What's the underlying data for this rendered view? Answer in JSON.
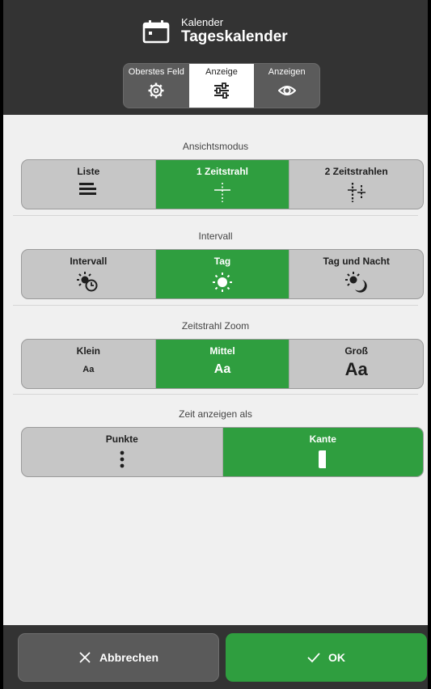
{
  "header": {
    "subtitle": "Kalender",
    "title": "Tageskalender",
    "icon": "calendar-icon",
    "tabs": [
      {
        "label": "Oberstes Feld",
        "icon": "gear-icon",
        "active": false
      },
      {
        "label": "Anzeige",
        "icon": "sliders-icon",
        "active": true
      },
      {
        "label": "Anzeigen",
        "icon": "eye-icon",
        "active": false
      }
    ]
  },
  "sections": {
    "view_mode": {
      "label": "Ansichtsmodus",
      "options": [
        {
          "label": "Liste",
          "icon": "list-icon"
        },
        {
          "label": "1 Zeitstrahl",
          "icon": "one-timeline-icon"
        },
        {
          "label": "2 Zeitstrahlen",
          "icon": "two-timelines-icon"
        }
      ],
      "selected": "1 Zeitstrahl"
    },
    "interval": {
      "label": "Intervall",
      "options": [
        {
          "label": "Intervall",
          "icon": "sun-clock-icon"
        },
        {
          "label": "Tag",
          "icon": "sun-icon"
        },
        {
          "label": "Tag und Nacht",
          "icon": "sun-moon-icon"
        }
      ],
      "selected": "Tag"
    },
    "zoom": {
      "label": "Zeitstrahl Zoom",
      "options": [
        {
          "label": "Klein",
          "sample": "Aa"
        },
        {
          "label": "Mittel",
          "sample": "Aa"
        },
        {
          "label": "Groß",
          "sample": "Aa"
        }
      ],
      "selected": "Mittel"
    },
    "time_display": {
      "label": "Zeit anzeigen als",
      "options": [
        {
          "label": "Punkte",
          "icon": "dots-icon"
        },
        {
          "label": "Kante",
          "icon": "edge-icon"
        }
      ],
      "selected": "Kante"
    }
  },
  "footer": {
    "cancel_label": "Abbrechen",
    "ok_label": "OK"
  },
  "colors": {
    "header_bg": "#333333",
    "accent_green": "#2f9e3f",
    "content_bg": "#f0f0f0",
    "segment_bg": "#c6c6c6"
  }
}
